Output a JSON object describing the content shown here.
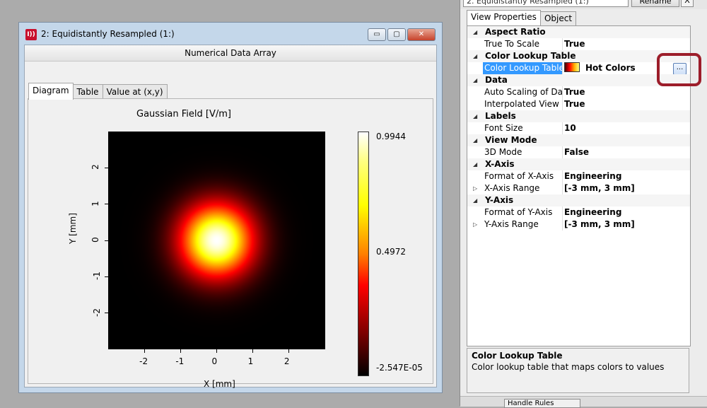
{
  "window": {
    "icon_text": "I))",
    "title": "2: Equidistantly Resampled (1:)",
    "subheader": "Numerical Data Array",
    "controls": {
      "minimize": "▭",
      "maximize": "▢",
      "close": "✕"
    },
    "tabs": [
      {
        "label": "Diagram",
        "active": true
      },
      {
        "label": "Table",
        "active": false
      },
      {
        "label": "Value at (x,y)",
        "active": false
      }
    ]
  },
  "chart_data": {
    "type": "heatmap",
    "title": "Gaussian Field  [V/m]",
    "xlabel": "X [mm]",
    "ylabel": "Y [mm]",
    "xlim": [
      -3,
      3
    ],
    "ylim": [
      -3,
      3
    ],
    "x_ticks": [
      "-2",
      "-1",
      "0",
      "1",
      "2"
    ],
    "y_ticks": [
      "2",
      "1",
      "0",
      "-1",
      "-2"
    ],
    "colormap": "Hot Colors",
    "colorbar_labels": {
      "max": "0.9944",
      "mid": "0.4972",
      "min": "-2.547E-05"
    },
    "value_max": 0.9944,
    "value_min": -2.547e-05,
    "field": {
      "center_x": 0,
      "center_y": 0,
      "waist_mm": 1.0
    }
  },
  "panel": {
    "combo_value": "2. Equidistantly Resampled (1:)",
    "rename_label": "Rename",
    "close_label": "X",
    "tabs": [
      {
        "label": "View Properties",
        "active": true
      },
      {
        "label": "Object",
        "active": false
      }
    ],
    "rows": [
      {
        "type": "cat",
        "name": "Aspect Ratio",
        "expander": "◢"
      },
      {
        "type": "prop",
        "name": "True To Scale",
        "value": "True"
      },
      {
        "type": "cat",
        "name": "Color Lookup Table",
        "expander": "◢"
      },
      {
        "type": "prop",
        "name": "Color Lookup Table",
        "value": "Hot Colors",
        "selected": true,
        "swatch": true,
        "button": "..."
      },
      {
        "type": "cat",
        "name": "Data",
        "expander": "◢"
      },
      {
        "type": "prop",
        "name": "Auto Scaling of Data",
        "value": "True"
      },
      {
        "type": "prop",
        "name": "Interpolated View",
        "value": "True"
      },
      {
        "type": "cat",
        "name": "Labels",
        "expander": "◢"
      },
      {
        "type": "prop",
        "name": "Font Size",
        "value": "10"
      },
      {
        "type": "cat",
        "name": "View Mode",
        "expander": "◢"
      },
      {
        "type": "prop",
        "name": "3D Mode",
        "value": "False"
      },
      {
        "type": "cat",
        "name": "X-Axis",
        "expander": "◢"
      },
      {
        "type": "prop",
        "name": "Format of X-Axis",
        "value": "Engineering"
      },
      {
        "type": "prop",
        "name": "X-Axis Range",
        "value": "[-3 mm, 3 mm]",
        "expander": "▷"
      },
      {
        "type": "cat",
        "name": "Y-Axis",
        "expander": "◢"
      },
      {
        "type": "prop",
        "name": "Format of Y-Axis",
        "value": "Engineering"
      },
      {
        "type": "prop",
        "name": "Y-Axis Range",
        "value": "[-3 mm, 3 mm]",
        "expander": "▷"
      }
    ],
    "description": {
      "title": "Color Lookup Table",
      "text": "Color lookup table that maps colors to values"
    },
    "bottom_tab": "Handle Rules"
  },
  "colors": {
    "selection": "#3399ff",
    "highlight": "#9c1d2a",
    "window_frame": "#c4d7ea"
  }
}
